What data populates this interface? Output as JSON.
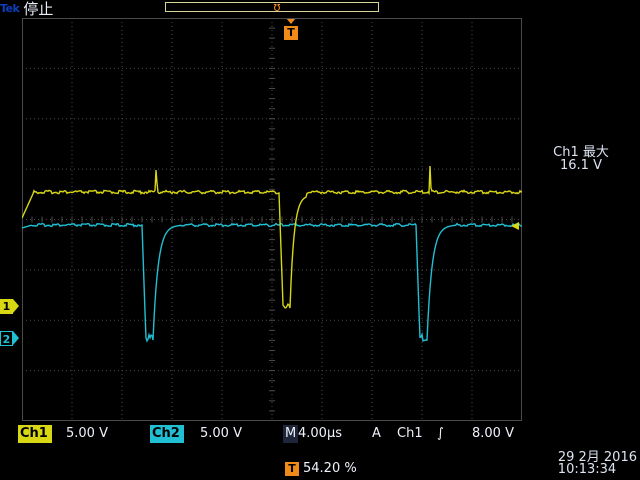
{
  "header": {
    "brand": "Tek",
    "acquisition_state": "停止"
  },
  "right_panel": {
    "measurement_label": "Ch1 最大",
    "measurement_value": "16.1 V"
  },
  "channels": {
    "ch1": {
      "label": "1",
      "tag": "Ch1",
      "scale": "5.00 V",
      "color": "#d7d714"
    },
    "ch2": {
      "label": "2",
      "tag": "Ch2",
      "scale": "5.00 V",
      "color": "#21bfd3"
    }
  },
  "timebase": {
    "mode": "M",
    "value": "4.00μs"
  },
  "trigger": {
    "marker": "T",
    "mode": "A",
    "source": "Ch1",
    "slope_icon": "rising-edge-icon",
    "slope_glyph": "∫",
    "level": "8.00 V",
    "position_percent": "54.20 %"
  },
  "datetime": {
    "date": "29 2月  2016",
    "time": "10:13:34"
  },
  "colors": {
    "ch1": "#d7d714",
    "ch2": "#21bfd3",
    "trigger": "#f08a18",
    "grid": "#4a4a4a"
  }
}
